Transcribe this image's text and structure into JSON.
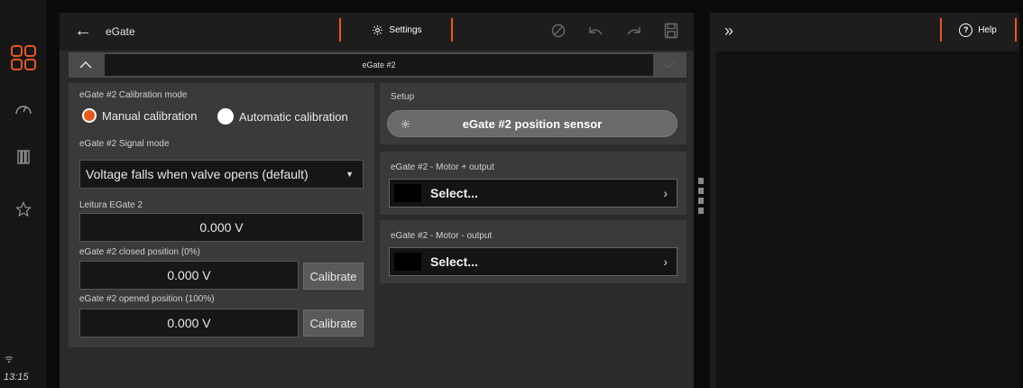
{
  "sidebar": {
    "clock": "13:15",
    "icons": [
      "apps-grid-icon",
      "gauge-icon",
      "columns-icon",
      "star-icon",
      "wifi-icon"
    ]
  },
  "header": {
    "title": "eGate",
    "settings_label": "Settings"
  },
  "section": {
    "title": "eGate #2"
  },
  "calibration": {
    "mode_label": "eGate #2 Calibration mode",
    "manual_label": "Manual calibration",
    "automatic_label": "Automatic calibration",
    "selected": "manual",
    "signal_mode_label": "eGate #2 Signal mode",
    "signal_mode_value": "Voltage falls when valve opens (default)",
    "reading_label": "Leitura EGate 2",
    "reading_value": "0.000 V",
    "closed_label": "eGate #2 closed position (0%)",
    "closed_value": "0.000 V",
    "opened_label": "eGate #2 opened position (100%)",
    "opened_value": "0.000 V",
    "calibrate_label": "Calibrate"
  },
  "setup": {
    "title": "Setup",
    "sensor_button": "eGate #2 position sensor",
    "motor_plus_label": "eGate #2 - Motor + output",
    "motor_plus_value": "Select...",
    "motor_minus_label": "eGate #2 - Motor - output",
    "motor_minus_value": "Select..."
  },
  "right_panel": {
    "help_label": "Help"
  },
  "colors": {
    "accent": "#e8581c",
    "panel": "#2b2b2b",
    "card": "#3a3a3a"
  }
}
